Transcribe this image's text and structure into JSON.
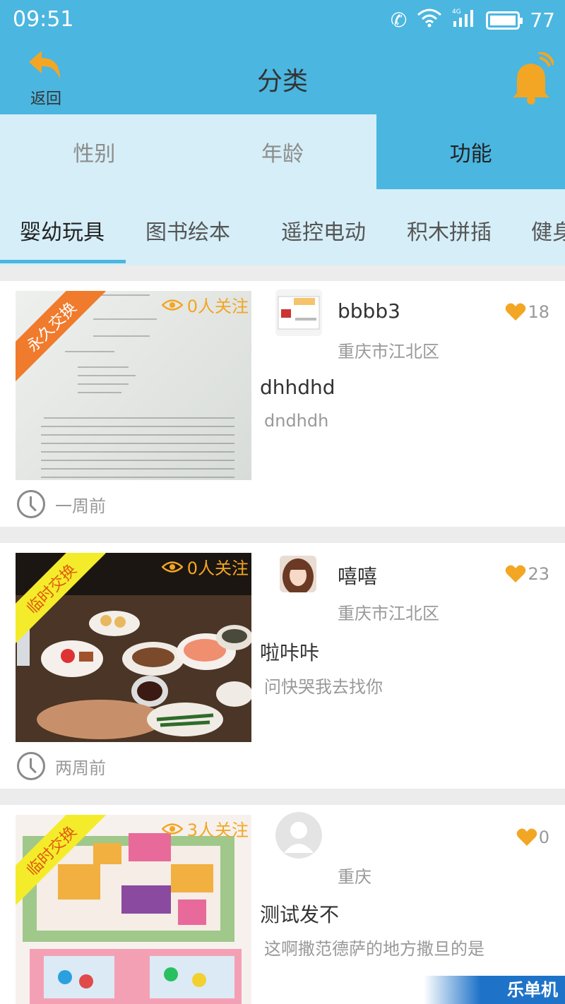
{
  "status": {
    "time": "09:51",
    "battery": "77",
    "network": "4G"
  },
  "header": {
    "back_label": "返回",
    "title": "分类"
  },
  "segments": [
    "性别",
    "年龄",
    "功能"
  ],
  "categories": [
    "婴幼玩具",
    "图书绘本",
    "遥控电动",
    "积木拼插",
    "健身"
  ],
  "items": [
    {
      "badge": "永久交换",
      "watchers": "0人关注",
      "username": "bbbb3",
      "location": "重庆市江北区",
      "likes": "18",
      "title": "dhhdhd",
      "desc": "dndhdh",
      "time": "一周前"
    },
    {
      "badge": "临时交换",
      "watchers": "0人关注",
      "username": "嘻嘻",
      "location": "重庆市江北区",
      "likes": "23",
      "title": "啦咔咔",
      "desc": "问快哭我去找你",
      "time": "两周前"
    },
    {
      "badge": "临时交换",
      "watchers": "3人关注",
      "username": "",
      "location": "重庆",
      "likes": "0",
      "title": "测试发不",
      "desc": "这啊撒范德萨的地方撒旦的是"
    }
  ],
  "watermark": "乐单机"
}
